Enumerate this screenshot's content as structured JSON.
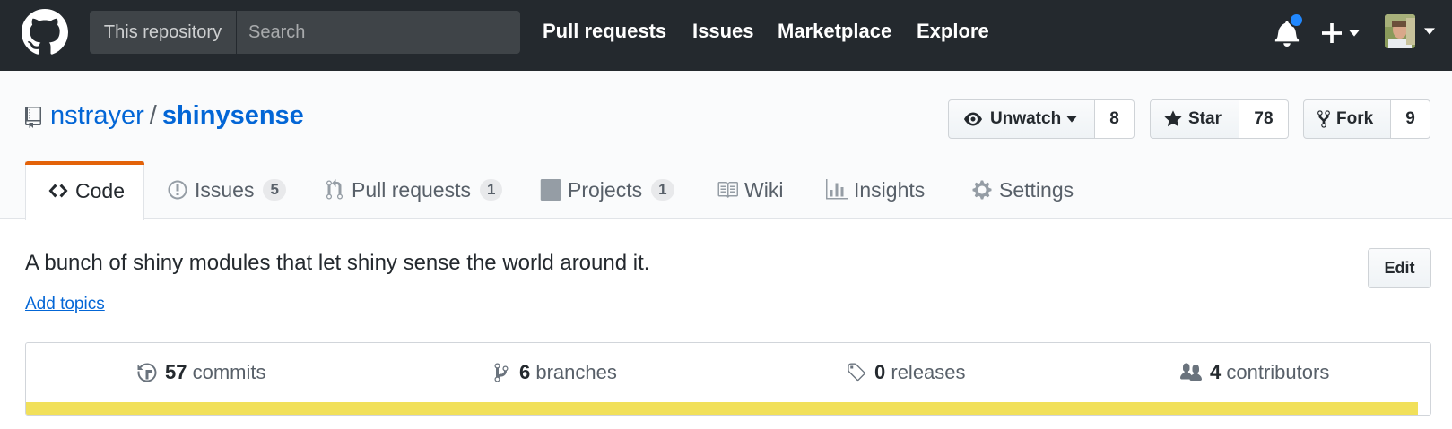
{
  "header": {
    "scope_label": "This repository",
    "search_placeholder": "Search",
    "nav": [
      "Pull requests",
      "Issues",
      "Marketplace",
      "Explore"
    ],
    "notification_color": "#2188ff",
    "icons": [
      "github-logo-icon",
      "bell-icon",
      "plus-icon",
      "chevron-down-icon",
      "avatar"
    ]
  },
  "repo": {
    "owner": "nstrayer",
    "separator": "/",
    "name": "shinysense",
    "watch": {
      "label": "Unwatch",
      "count": "8",
      "icon": "eye-icon"
    },
    "star": {
      "label": "Star",
      "count": "78",
      "icon": "star-icon"
    },
    "fork": {
      "label": "Fork",
      "count": "9",
      "icon": "fork-icon"
    }
  },
  "tabs": [
    {
      "label": "Code",
      "icon": "code-icon",
      "selected": true
    },
    {
      "label": "Issues",
      "icon": "issue-icon",
      "counter": "5"
    },
    {
      "label": "Pull requests",
      "icon": "pull-request-icon",
      "counter": "1"
    },
    {
      "label": "Projects",
      "icon": "project-icon",
      "counter": "1"
    },
    {
      "label": "Wiki",
      "icon": "book-icon"
    },
    {
      "label": "Insights",
      "icon": "graph-icon"
    },
    {
      "label": "Settings",
      "icon": "gear-icon"
    }
  ],
  "description": {
    "text": "A bunch of shiny modules that let shiny sense the world around it.",
    "add_topics": "Add topics",
    "edit_label": "Edit"
  },
  "summary": {
    "commits": {
      "count": "57",
      "label": "commits",
      "icon": "history-icon"
    },
    "branches": {
      "count": "6",
      "label": "branches",
      "icon": "branch-icon"
    },
    "releases": {
      "count": "0",
      "label": "releases",
      "icon": "tag-icon"
    },
    "contributors": {
      "count": "4",
      "label": "contributors",
      "icon": "people-icon"
    }
  },
  "language_bar": [
    {
      "color": "#f1e05a",
      "fraction": 0.99
    },
    {
      "color": "#ffffff",
      "fraction": 0.01
    }
  ]
}
